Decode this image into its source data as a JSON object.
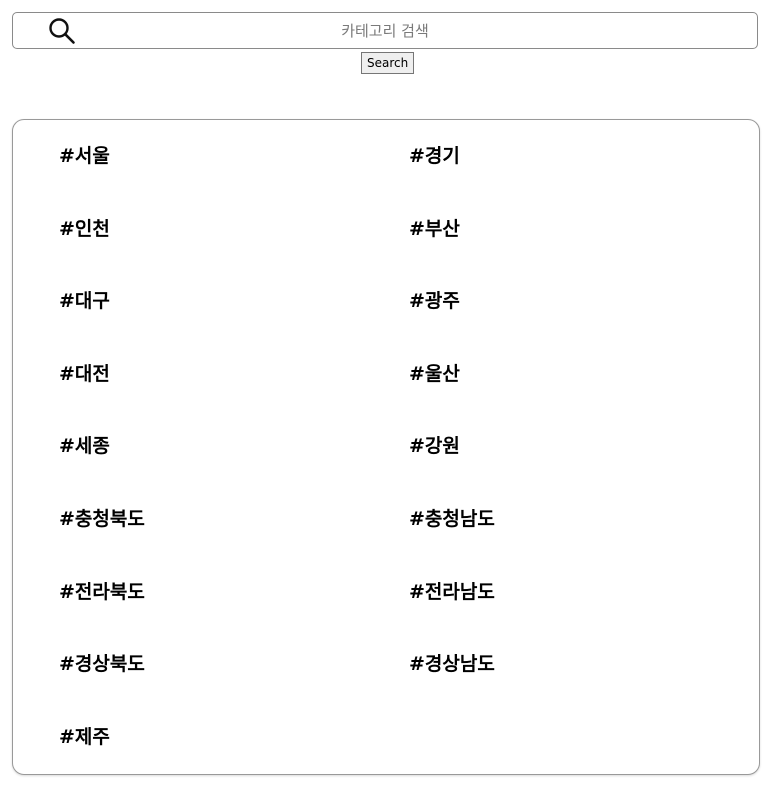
{
  "search": {
    "placeholder": "카테고리 검색",
    "value": "",
    "button_label": "Search",
    "icon": "search-icon"
  },
  "categories": [
    {
      "id": "seoul",
      "label": "#서울"
    },
    {
      "id": "gyeonggi",
      "label": "#경기"
    },
    {
      "id": "incheon",
      "label": "#인천"
    },
    {
      "id": "busan",
      "label": "#부산"
    },
    {
      "id": "daegu",
      "label": "#대구"
    },
    {
      "id": "gwangju",
      "label": "#광주"
    },
    {
      "id": "daejeon",
      "label": "#대전"
    },
    {
      "id": "ulsan",
      "label": "#울산"
    },
    {
      "id": "sejong",
      "label": "#세종"
    },
    {
      "id": "gangwon",
      "label": "#강원"
    },
    {
      "id": "chungbuk",
      "label": "#충청북도"
    },
    {
      "id": "chungnam",
      "label": "#충청남도"
    },
    {
      "id": "jeonbuk",
      "label": "#전라북도"
    },
    {
      "id": "jeonnam",
      "label": "#전라남도"
    },
    {
      "id": "gyeongbuk",
      "label": "#경상북도"
    },
    {
      "id": "gyeongnam",
      "label": "#경상남도"
    },
    {
      "id": "jeju",
      "label": "#제주"
    }
  ]
}
